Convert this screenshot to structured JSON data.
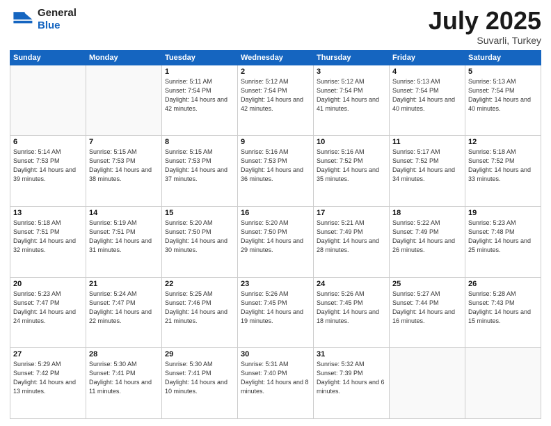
{
  "logo": {
    "general": "General",
    "blue": "Blue"
  },
  "header": {
    "month": "July 2025",
    "location": "Suvarli, Turkey"
  },
  "weekdays": [
    "Sunday",
    "Monday",
    "Tuesday",
    "Wednesday",
    "Thursday",
    "Friday",
    "Saturday"
  ],
  "weeks": [
    [
      {
        "day": null,
        "info": ""
      },
      {
        "day": null,
        "info": ""
      },
      {
        "day": "1",
        "sunrise": "5:11 AM",
        "sunset": "7:54 PM",
        "daylight": "14 hours and 42 minutes."
      },
      {
        "day": "2",
        "sunrise": "5:12 AM",
        "sunset": "7:54 PM",
        "daylight": "14 hours and 42 minutes."
      },
      {
        "day": "3",
        "sunrise": "5:12 AM",
        "sunset": "7:54 PM",
        "daylight": "14 hours and 41 minutes."
      },
      {
        "day": "4",
        "sunrise": "5:13 AM",
        "sunset": "7:54 PM",
        "daylight": "14 hours and 40 minutes."
      },
      {
        "day": "5",
        "sunrise": "5:13 AM",
        "sunset": "7:54 PM",
        "daylight": "14 hours and 40 minutes."
      }
    ],
    [
      {
        "day": "6",
        "sunrise": "5:14 AM",
        "sunset": "7:53 PM",
        "daylight": "14 hours and 39 minutes."
      },
      {
        "day": "7",
        "sunrise": "5:15 AM",
        "sunset": "7:53 PM",
        "daylight": "14 hours and 38 minutes."
      },
      {
        "day": "8",
        "sunrise": "5:15 AM",
        "sunset": "7:53 PM",
        "daylight": "14 hours and 37 minutes."
      },
      {
        "day": "9",
        "sunrise": "5:16 AM",
        "sunset": "7:53 PM",
        "daylight": "14 hours and 36 minutes."
      },
      {
        "day": "10",
        "sunrise": "5:16 AM",
        "sunset": "7:52 PM",
        "daylight": "14 hours and 35 minutes."
      },
      {
        "day": "11",
        "sunrise": "5:17 AM",
        "sunset": "7:52 PM",
        "daylight": "14 hours and 34 minutes."
      },
      {
        "day": "12",
        "sunrise": "5:18 AM",
        "sunset": "7:52 PM",
        "daylight": "14 hours and 33 minutes."
      }
    ],
    [
      {
        "day": "13",
        "sunrise": "5:18 AM",
        "sunset": "7:51 PM",
        "daylight": "14 hours and 32 minutes."
      },
      {
        "day": "14",
        "sunrise": "5:19 AM",
        "sunset": "7:51 PM",
        "daylight": "14 hours and 31 minutes."
      },
      {
        "day": "15",
        "sunrise": "5:20 AM",
        "sunset": "7:50 PM",
        "daylight": "14 hours and 30 minutes."
      },
      {
        "day": "16",
        "sunrise": "5:20 AM",
        "sunset": "7:50 PM",
        "daylight": "14 hours and 29 minutes."
      },
      {
        "day": "17",
        "sunrise": "5:21 AM",
        "sunset": "7:49 PM",
        "daylight": "14 hours and 28 minutes."
      },
      {
        "day": "18",
        "sunrise": "5:22 AM",
        "sunset": "7:49 PM",
        "daylight": "14 hours and 26 minutes."
      },
      {
        "day": "19",
        "sunrise": "5:23 AM",
        "sunset": "7:48 PM",
        "daylight": "14 hours and 25 minutes."
      }
    ],
    [
      {
        "day": "20",
        "sunrise": "5:23 AM",
        "sunset": "7:47 PM",
        "daylight": "14 hours and 24 minutes."
      },
      {
        "day": "21",
        "sunrise": "5:24 AM",
        "sunset": "7:47 PM",
        "daylight": "14 hours and 22 minutes."
      },
      {
        "day": "22",
        "sunrise": "5:25 AM",
        "sunset": "7:46 PM",
        "daylight": "14 hours and 21 minutes."
      },
      {
        "day": "23",
        "sunrise": "5:26 AM",
        "sunset": "7:45 PM",
        "daylight": "14 hours and 19 minutes."
      },
      {
        "day": "24",
        "sunrise": "5:26 AM",
        "sunset": "7:45 PM",
        "daylight": "14 hours and 18 minutes."
      },
      {
        "day": "25",
        "sunrise": "5:27 AM",
        "sunset": "7:44 PM",
        "daylight": "14 hours and 16 minutes."
      },
      {
        "day": "26",
        "sunrise": "5:28 AM",
        "sunset": "7:43 PM",
        "daylight": "14 hours and 15 minutes."
      }
    ],
    [
      {
        "day": "27",
        "sunrise": "5:29 AM",
        "sunset": "7:42 PM",
        "daylight": "14 hours and 13 minutes."
      },
      {
        "day": "28",
        "sunrise": "5:30 AM",
        "sunset": "7:41 PM",
        "daylight": "14 hours and 11 minutes."
      },
      {
        "day": "29",
        "sunrise": "5:30 AM",
        "sunset": "7:41 PM",
        "daylight": "14 hours and 10 minutes."
      },
      {
        "day": "30",
        "sunrise": "5:31 AM",
        "sunset": "7:40 PM",
        "daylight": "14 hours and 8 minutes."
      },
      {
        "day": "31",
        "sunrise": "5:32 AM",
        "sunset": "7:39 PM",
        "daylight": "14 hours and 6 minutes."
      },
      {
        "day": null,
        "info": ""
      },
      {
        "day": null,
        "info": ""
      }
    ]
  ],
  "labels": {
    "sunrise": "Sunrise:",
    "sunset": "Sunset:",
    "daylight": "Daylight:"
  }
}
